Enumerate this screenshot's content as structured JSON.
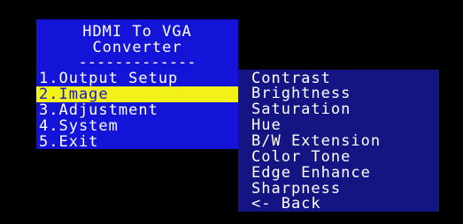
{
  "colors": {
    "background": "#000000",
    "main_panel": "#1414d8",
    "sub_panel": "#141482",
    "highlight": "#f2f218",
    "text": "#ffffff"
  },
  "main_menu": {
    "title_line1": "HDMI To VGA",
    "title_line2": "Converter",
    "divider": "-------------",
    "selected_index": 1,
    "items": [
      {
        "label": "1.Output Setup"
      },
      {
        "label": "2.Image"
      },
      {
        "label": "3.Adjustment"
      },
      {
        "label": "4.System"
      },
      {
        "label": "5.Exit"
      }
    ]
  },
  "image_submenu": {
    "items": [
      {
        "label": "Contrast"
      },
      {
        "label": "Brightness"
      },
      {
        "label": "Saturation"
      },
      {
        "label": "Hue"
      },
      {
        "label": "B/W Extension"
      },
      {
        "label": "Color Tone"
      },
      {
        "label": "Edge Enhance"
      },
      {
        "label": "Sharpness"
      },
      {
        "label": "<- Back"
      }
    ]
  }
}
